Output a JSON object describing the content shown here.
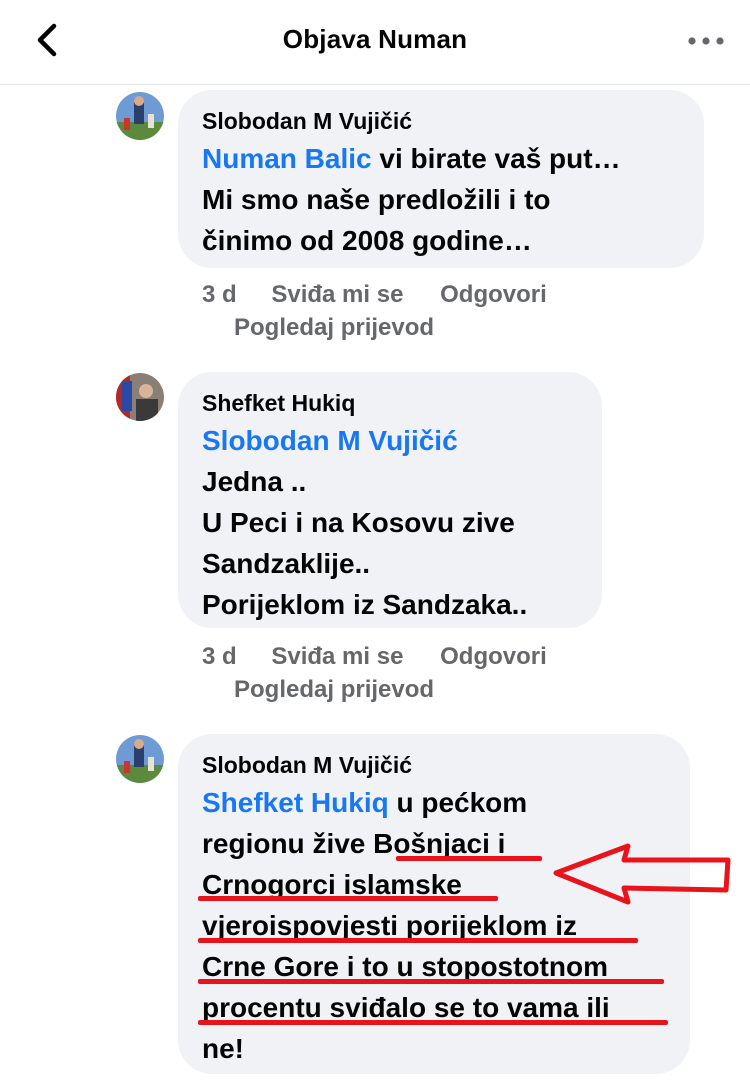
{
  "header": {
    "title": "Objava Numan",
    "back_icon": "chevron-left-icon",
    "more_icon": "more-dots-icon"
  },
  "comments": [
    {
      "author": "Slobodan M Vujičić",
      "mention": "Numan Balic",
      "lines": [
        " vi birate vaš put…",
        "Mi smo naše predložili i to",
        "činimo od 2008 godine…"
      ],
      "time": "3 d",
      "like": "Sviđa mi se",
      "reply": "Odgovori",
      "translate": "Pogledaj prijevod"
    },
    {
      "author": "Shefket Hukiq",
      "mention": "Slobodan M Vujičić",
      "lines": [
        "Jedna ..",
        "U Peci i na Kosovu zive",
        "Sandzaklije..",
        "Porijeklom iz Sandzaka.."
      ],
      "time": "3 d",
      "like": "Sviđa mi se",
      "reply": "Odgovori",
      "translate": "Pogledaj prijevod"
    },
    {
      "author": "Slobodan M Vujičić",
      "mention": "Shefket Hukiq",
      "lines": [
        " u pećkom",
        "regionu žive Bošnjaci i",
        "Crnogorci islamske",
        "vjeroispovjesti porijeklom iz",
        "Crne Gore i to u stopostotnom",
        "procentu sviđalo se to vama ili",
        "ne!"
      ]
    }
  ],
  "colors": {
    "accent": "#1877f2",
    "bubble": "#f0f2f5",
    "meta": "#65676b",
    "annotation": "#e8131b"
  }
}
